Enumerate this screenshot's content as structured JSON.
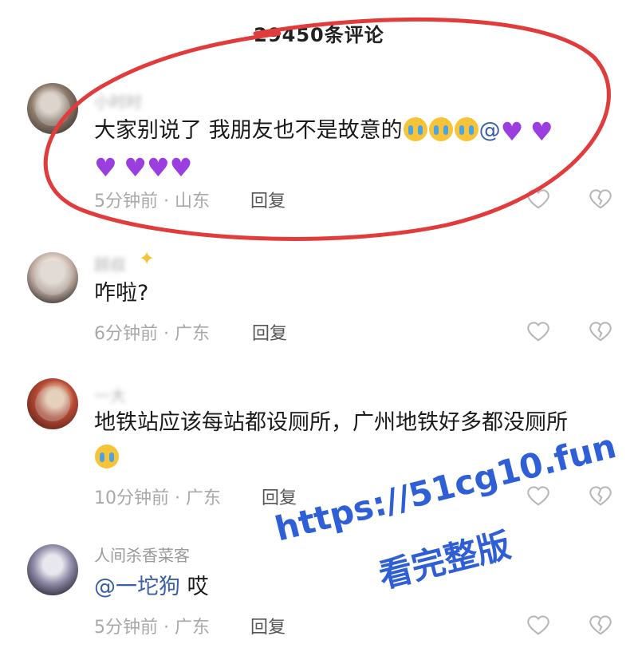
{
  "header": {
    "comment_count_title": "29450条评论"
  },
  "comments": [
    {
      "username": "小时时",
      "text_main": "大家别说了 我朋友也不是故意的",
      "mention": "@",
      "time": "5分钟前",
      "location": "山东",
      "reply_label": "回复"
    },
    {
      "username": "顾叔",
      "text_main": "咋啦?",
      "time": "6分钟前",
      "location": "广东",
      "reply_label": "回复"
    },
    {
      "username": "一大",
      "text_line1": "地铁站应该每站都设厕所，广州地铁好多都没厕所",
      "time": "10分钟前",
      "location": "广东",
      "reply_label": "回复"
    },
    {
      "username": "人间杀香菜客",
      "mention": "@一坨狗",
      "text_after": " 哎",
      "time": "5分钟前",
      "location": "广东",
      "reply_label": "回复"
    }
  ],
  "meta_separator": " · ",
  "watermark": {
    "line1": "https://51cg10.fun",
    "line2": "看完整版"
  },
  "colors": {
    "highlight": "#e23b3b",
    "heart": "#9b3ee0",
    "watermark": "#2f5fd6"
  },
  "icons": [
    "heart-outline-icon",
    "broken-heart-icon",
    "crying-emoji-icon",
    "purple-heart-icon",
    "sparkle-star-icon"
  ]
}
